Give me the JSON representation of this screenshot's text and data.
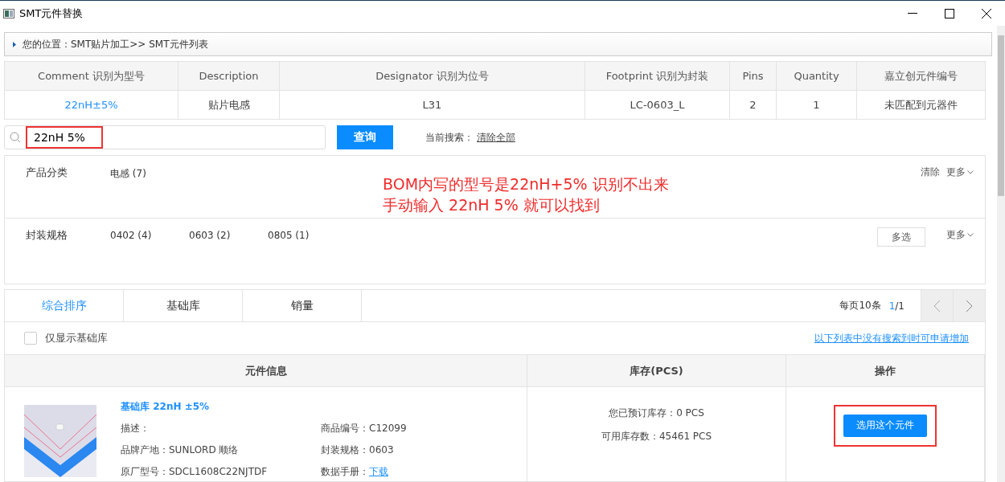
{
  "window": {
    "title": "SMT元件替换"
  },
  "breadcrumb": "您的位置：SMT贴片加工>> SMT元件列表",
  "bom_table": {
    "columns": [
      "Comment 识别为型号",
      "Description",
      "Designator 识别为位号",
      "Footprint 识别为封装",
      "Pins",
      "Quantity",
      "嘉立创元件编号"
    ],
    "row": [
      "22nH±5%",
      "贴片电感",
      "L31",
      "LC-0603_L",
      "2",
      "1",
      "未匹配到元器件"
    ]
  },
  "search": {
    "value": "22nH 5%",
    "button": "查询",
    "current_label": "当前搜索：",
    "clear_all": "清除全部"
  },
  "filters": [
    {
      "label": "产品分类",
      "options": [
        "电感 (7)"
      ],
      "actions": [
        "清除",
        "更多"
      ],
      "kind": "plain"
    },
    {
      "label": "封装规格",
      "options": [
        "0402 (4)",
        "0603 (2)",
        "0805 (1)"
      ],
      "actions": [
        "多选",
        "更多"
      ],
      "kind": "multi"
    }
  ],
  "annotation": {
    "lines": [
      "BOM内写的型号是22nH+5% 识别不出来",
      "手动输入 22nH 5% 就可以找到"
    ]
  },
  "sort_tabs": [
    {
      "label": "综合排序",
      "selected": true
    },
    {
      "label": "基础库",
      "selected": false
    },
    {
      "label": "销量",
      "selected": false
    }
  ],
  "pagination": {
    "per_page": "每页10条",
    "current": "1",
    "total": "/1"
  },
  "basic_only": {
    "label": "仅显示基础库",
    "checked": false
  },
  "request_link": "以下列表中没有搜索到时可申请增加",
  "results": {
    "columns": [
      "元件信息",
      "库存(PCS)",
      "操作"
    ],
    "rows": [
      {
        "name": "基础库 22nH ±5%",
        "fields": [
          {
            "label": "描述："
          },
          {
            "label": "商品编号：",
            "value": "C12099"
          },
          {
            "label": "品牌产地：",
            "value": "SUNLORD 顺络"
          },
          {
            "label": "封装规格：",
            "value": "0603"
          },
          {
            "label": "原厂型号：",
            "value": "SDCL1608C22NJTDF"
          },
          {
            "label": "数据手册：",
            "value": "下载",
            "kind": "link"
          }
        ],
        "stock": [
          "您已预订库存：0 PCS",
          "可用库存数：45461 PCS"
        ],
        "action": "选用这个元件"
      }
    ]
  }
}
